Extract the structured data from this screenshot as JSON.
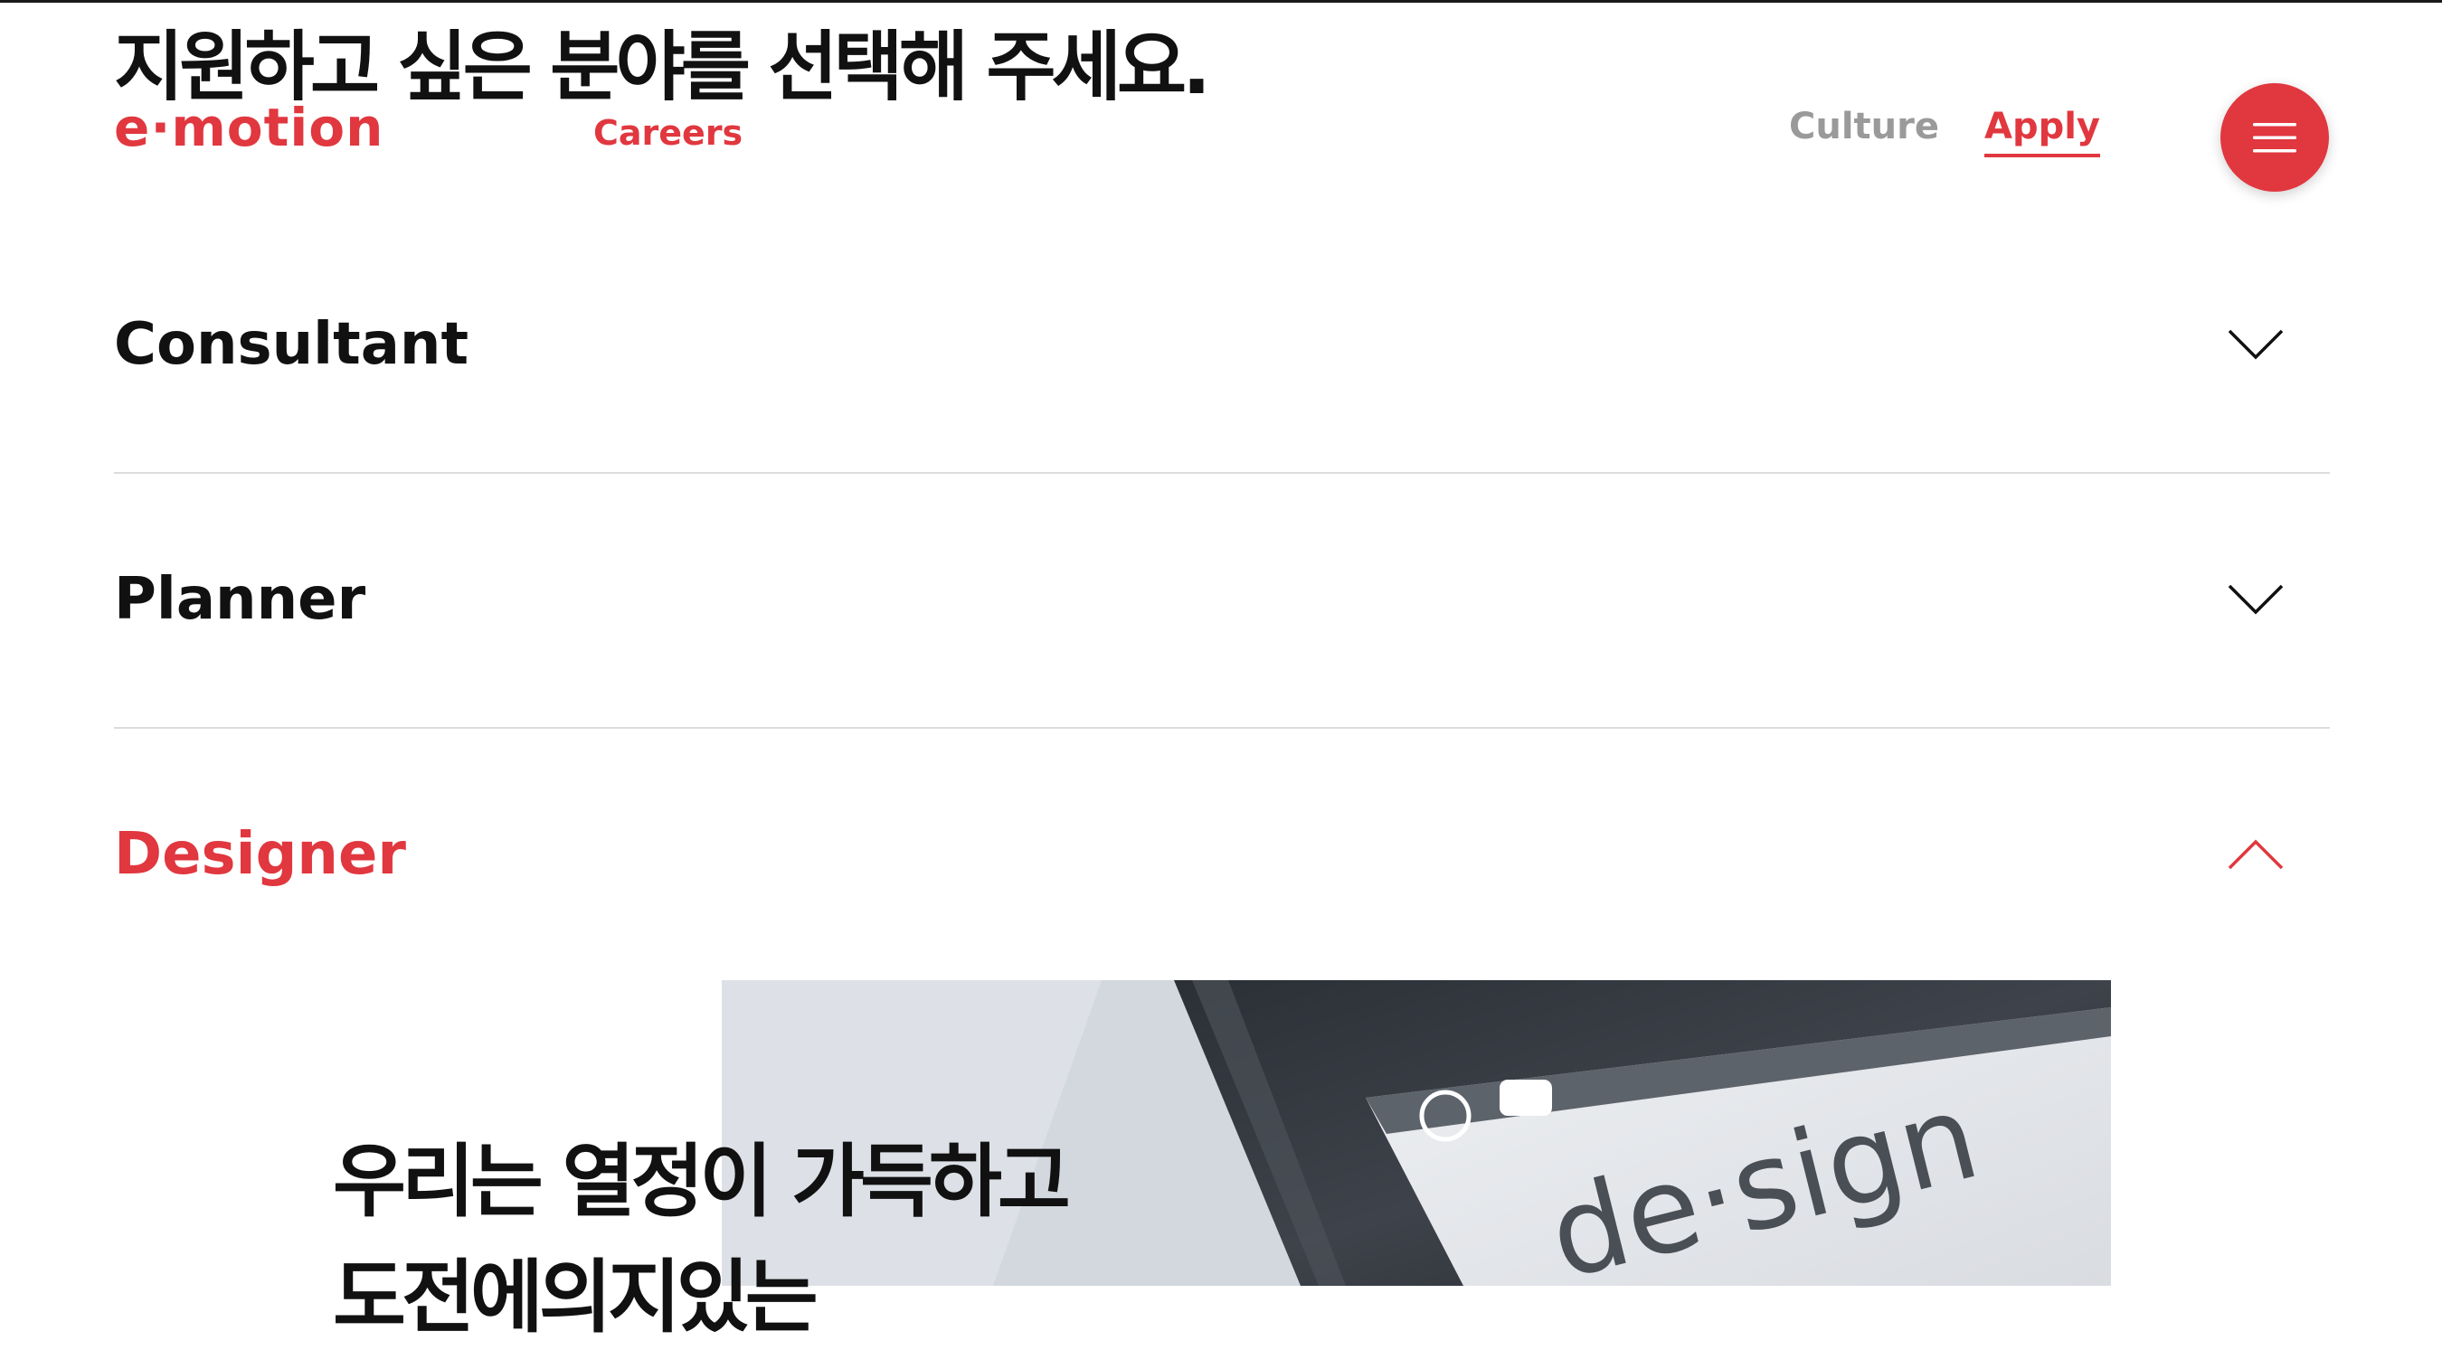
{
  "header": {
    "title": "지원하고 싶은 분야를 선택해 주세요.",
    "logo_text": "e·motion",
    "section_label": "Careers",
    "nav": {
      "culture": "Culture",
      "apply": "Apply"
    },
    "menu_icon": "hamburger-icon"
  },
  "accordion": {
    "items": [
      {
        "label": "Consultant",
        "expanded": false,
        "icon": "chevron-down-icon"
      },
      {
        "label": "Planner",
        "expanded": false,
        "icon": "chevron-down-icon"
      },
      {
        "label": "Designer",
        "expanded": true,
        "icon": "chevron-up-icon"
      }
    ]
  },
  "designer_panel": {
    "heading_line1": "우리는 열정이 가득하고",
    "heading_line2": "도전에의지있는",
    "image_text": "de·sign"
  },
  "colors": {
    "accent": "#e1373f",
    "text": "#111111",
    "muted": "#9a9a9a",
    "divider": "#dcdcdc"
  }
}
